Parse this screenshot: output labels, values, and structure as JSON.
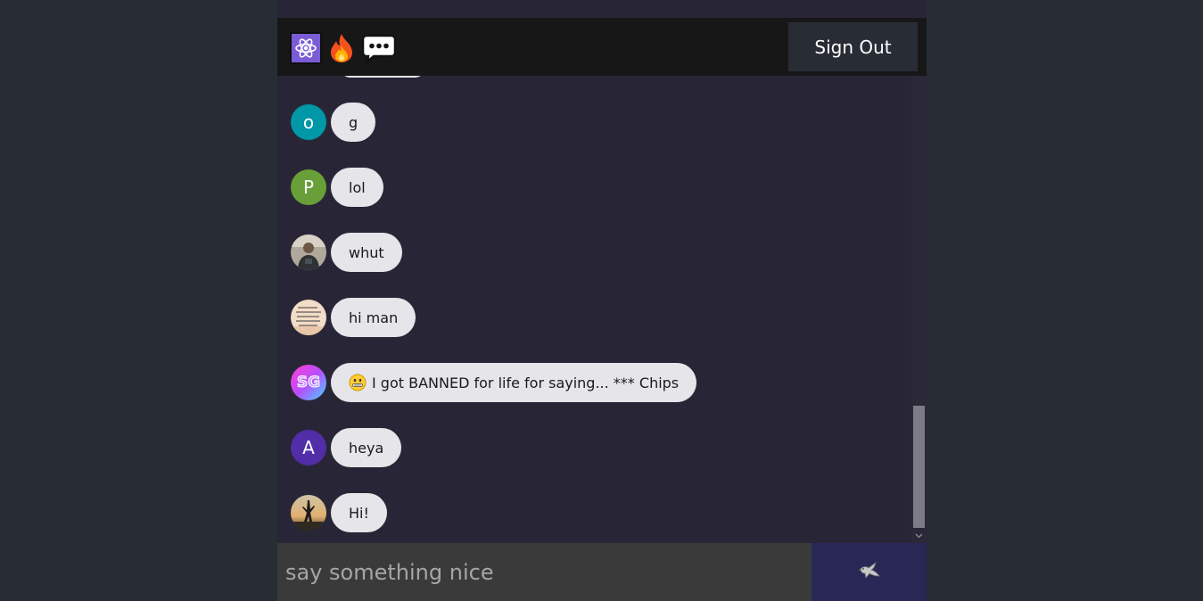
{
  "header": {
    "icons": [
      "atom-icon",
      "fire-icon",
      "speech-bubble-icon"
    ],
    "sign_out_label": "Sign Out"
  },
  "messages": [
    {
      "avatar_type": "letter",
      "avatar_letter": "o",
      "avatar_color": "#0097a7",
      "text": "g"
    },
    {
      "avatar_type": "letter",
      "avatar_letter": "P",
      "avatar_color": "#689f38",
      "text": "lol"
    },
    {
      "avatar_type": "photo",
      "avatar_icon": "user-photo-avatar",
      "text": "whut"
    },
    {
      "avatar_type": "photo",
      "avatar_icon": "handwritten-note-avatar",
      "text": "hi man"
    },
    {
      "avatar_type": "logo",
      "avatar_letter": "SG",
      "text": "I got BANNED for life for saying... *** Chips",
      "emoji": "zipper-mouth-face-icon"
    },
    {
      "avatar_type": "letter",
      "avatar_letter": "A",
      "avatar_color": "#512da8",
      "text": "heya"
    },
    {
      "avatar_type": "photo",
      "avatar_icon": "sunset-photo-avatar",
      "text": "Hi!"
    }
  ],
  "composer": {
    "placeholder": "say something nice",
    "value": "",
    "send_icon": "dove-icon"
  },
  "colors": {
    "page_bg": "#282c34",
    "app_bg": "#282636",
    "header_bg": "#181717",
    "bubble_bg": "#e5e5ea",
    "input_bg": "#3a3a3a",
    "send_bg": "#282755"
  }
}
